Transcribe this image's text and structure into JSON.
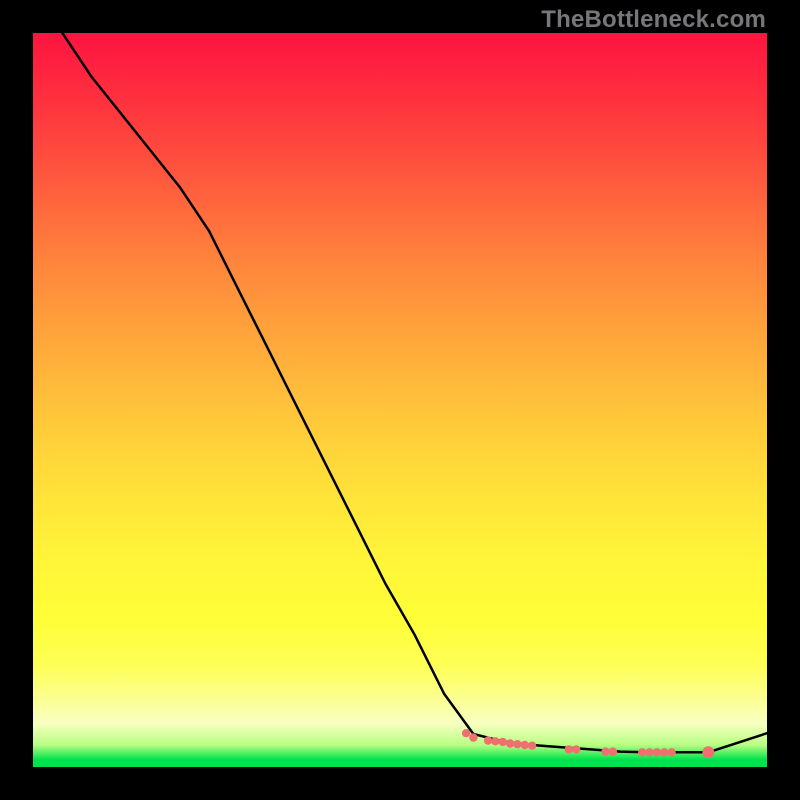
{
  "watermark": "TheBottleneck.com",
  "chart_data": {
    "type": "line",
    "title": "",
    "xlabel": "",
    "ylabel": "",
    "ylim": [
      0,
      100
    ],
    "x": [
      0,
      4,
      8,
      12,
      16,
      20,
      24,
      28,
      32,
      36,
      40,
      44,
      48,
      52,
      56,
      60,
      64,
      68,
      72,
      76,
      80,
      84,
      88,
      92,
      96,
      100
    ],
    "series": [
      {
        "name": "bottleneck-curve",
        "values": [
          105,
          100,
          94,
          89,
          84,
          79,
          73,
          65,
          57,
          49,
          41,
          33,
          25,
          18,
          10,
          4.5,
          3.5,
          3,
          2.7,
          2.4,
          2.1,
          2,
          2,
          2,
          3.3,
          4.6
        ]
      }
    ],
    "highlight_dots": {
      "name": "highlight-range",
      "x": [
        59,
        60,
        62,
        63,
        64,
        65,
        66,
        67,
        68,
        73,
        74,
        78,
        79,
        83,
        84,
        85,
        86,
        87,
        92
      ],
      "values": [
        4.6,
        4.0,
        3.6,
        3.5,
        3.4,
        3.2,
        3.1,
        3.0,
        2.9,
        2.4,
        2.4,
        2.1,
        2.1,
        2.0,
        2.0,
        2.0,
        2.0,
        2.0,
        2.0
      ],
      "color": "#f07070"
    },
    "end_marker": {
      "x": 92,
      "y": 2.0,
      "color": "#f07070",
      "radius_px": 6
    }
  }
}
